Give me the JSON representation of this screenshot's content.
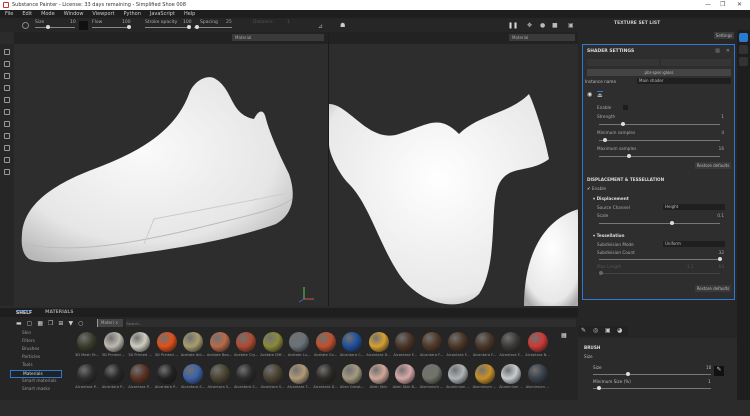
{
  "window": {
    "title": "Substance Painter - License: 33 days remaining - Simplified Shoe 008",
    "minimize": "—",
    "maximize": "❐",
    "close": "✕"
  },
  "menu": [
    "File",
    "Edit",
    "Mode",
    "Window",
    "Viewport",
    "Python",
    "JavaScript",
    "Help"
  ],
  "toolbar": {
    "size_label": "Size",
    "size_value": "10",
    "flow_label": "Flow",
    "flow_value": "100",
    "stroke_opacity_label": "Stroke opacity",
    "stroke_opacity_value": "100",
    "spacing_label": "Spacing",
    "spacing_value": "25",
    "distance_label": "Distance",
    "distance_value": "1"
  },
  "viewports": {
    "left_mode": "Material",
    "right_mode": "Material"
  },
  "texture_set_list": {
    "title": "TEXTURE SET LIST",
    "settings_label": "Settings"
  },
  "shader_settings": {
    "title": "SHADER SETTINGS",
    "shader_name": "pbr-spec-gloss",
    "instance_label": "Instance name",
    "instance_value": "Main shader",
    "enable_label": "Enable",
    "strength_label": "Strength",
    "strength_value": "1",
    "min_samples_label": "Minimum samples",
    "min_samples_value": "4",
    "max_samples_label": "Maximum samples",
    "max_samples_value": "16",
    "restore": "Restore defaults",
    "disp_title": "DISPLACEMENT & TESSELLATION",
    "disp_enable": "Enable",
    "displacement": "Displacement",
    "source_channel_label": "Source Channel",
    "source_channel_value": "Height",
    "scale_label": "Scale",
    "scale_value": "0.1",
    "tessellation": "Tessellation",
    "subdiv_mode_label": "Subdivision Mode",
    "subdiv_mode_value": "Uniform",
    "subdiv_count_label": "Subdivision Count",
    "subdiv_count_value": "32",
    "max_length_label": "Max Length",
    "max_length_value": "1.1",
    "max_length_max": "64",
    "restore2": "Restore defaults",
    "strength": 0.2,
    "min_samples": 0.05,
    "max_samples": 0.25,
    "scale": 0.6,
    "subdiv_count": 1.0
  },
  "shelf": {
    "tab1": "SHELF",
    "tab2": "MATERIALS",
    "filter_chip": "Materi",
    "search_placeholder": "Search...",
    "tree": [
      "Skin",
      "Filters",
      "Brushes",
      "Particles",
      "Tools",
      "Materials",
      "Smart materials",
      "Smart masks"
    ],
    "selected": "Materials",
    "materials": [
      {
        "n": "3D Mesh Te...",
        "c": "#3a3d2c"
      },
      {
        "n": "3D Printed ...",
        "c": "#bdbab0"
      },
      {
        "n": "3D Printed ...",
        "c": "#d0cdc0"
      },
      {
        "n": "3D Printed ...",
        "c": "#e0501a"
      },
      {
        "n": "Acetate Ant...",
        "c": "#a89d70"
      },
      {
        "n": "Acetate Bea...",
        "c": "#b86a4a"
      },
      {
        "n": "Acetate Cry...",
        "c": "#b04a32"
      },
      {
        "n": "Acetate Diff...",
        "c": "#8a8a3a"
      },
      {
        "n": "Acetate Lu...",
        "c": "#6a7278"
      },
      {
        "n": "Acetate Ov...",
        "c": "#c0502e"
      },
      {
        "n": "Alcantara C...",
        "c": "#1f4f9a"
      },
      {
        "n": "Alcantara D...",
        "c": "#d4a032"
      },
      {
        "n": "Alcantara F...",
        "c": "#4a3426"
      },
      {
        "n": "Alcantara F...",
        "c": "#503828"
      },
      {
        "n": "Alcantara F...",
        "c": "#4c3626"
      },
      {
        "n": "Alcantara F...",
        "c": "#4a3628"
      },
      {
        "n": "Alcantara F...",
        "c": "#3c3a38"
      },
      {
        "n": "Alcantara N...",
        "c": "#cc3a36"
      },
      {
        "n": "Alcantara P...",
        "c": "#2c2c2c"
      },
      {
        "n": "Alcantara P...",
        "c": "#262626"
      },
      {
        "n": "Alcantara P...",
        "c": "#5a3222"
      },
      {
        "n": "Alcantara P...",
        "c": "#222"
      },
      {
        "n": "Alcantara S...",
        "c": "#3c62a8"
      },
      {
        "n": "Alcantara S...",
        "c": "#4a4430"
      },
      {
        "n": "Alcantara S...",
        "c": "#2a2a2a"
      },
      {
        "n": "Alcantara S...",
        "c": "#4a4232"
      },
      {
        "n": "Alcantara T...",
        "c": "#b09a78"
      },
      {
        "n": "Alcantara D...",
        "c": "#2c2a26"
      },
      {
        "n": "Alien Growt...",
        "c": "#a49a80"
      },
      {
        "n": "Alien Skin",
        "c": "#d0a898"
      },
      {
        "n": "Alien Skin B...",
        "c": "#d8a8a8"
      },
      {
        "n": "Aluminium ...",
        "c": "#707468"
      },
      {
        "n": "Aluminium ...",
        "c": "#b0b4b8"
      },
      {
        "n": "Aluminium ...",
        "c": "#c89028"
      },
      {
        "n": "Aluminium ...",
        "c": "#c8ccd0"
      },
      {
        "n": "Aluminium ...",
        "c": "#38404a"
      }
    ]
  },
  "brush": {
    "title": "BRUSH",
    "section": "Size",
    "size_label": "Size",
    "size_value": "10",
    "min_size_label": "Minimum Size (%)",
    "min_size_value": "1",
    "size": 0.3,
    "min_size": 0.05
  },
  "colors": {
    "accent": "#2a7bd0"
  }
}
